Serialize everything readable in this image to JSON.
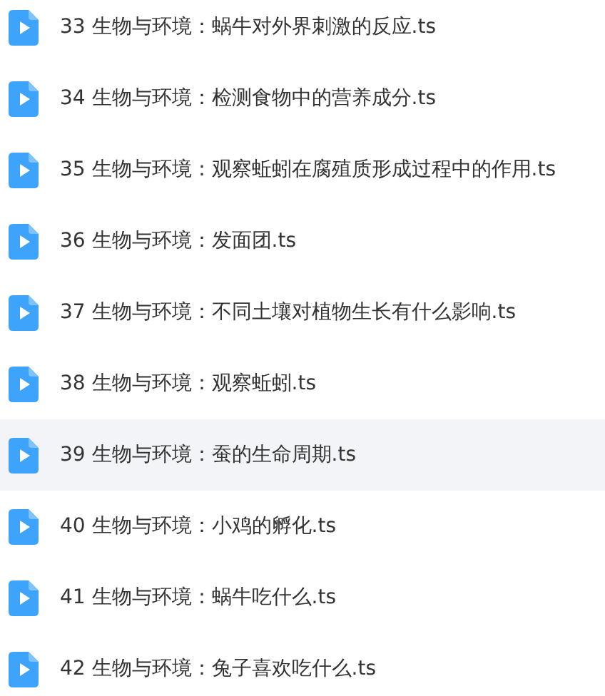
{
  "files": [
    {
      "name": "33 生物与环境：蜗牛对外界刺激的反应.ts",
      "selected": false
    },
    {
      "name": "34 生物与环境：检测食物中的营养成分.ts",
      "selected": false
    },
    {
      "name": "35 生物与环境：观察蚯蚓在腐殖质形成过程中的作用.ts",
      "selected": false
    },
    {
      "name": "36 生物与环境：发面团.ts",
      "selected": false
    },
    {
      "name": "37 生物与环境：不同土壤对植物生长有什么影响.ts",
      "selected": false
    },
    {
      "name": "38 生物与环境：观察蚯蚓.ts",
      "selected": false
    },
    {
      "name": "39 生物与环境：蚕的生命周期.ts",
      "selected": true
    },
    {
      "name": "40 生物与环境：小鸡的孵化.ts",
      "selected": false
    },
    {
      "name": "41 生物与环境：蜗牛吃什么.ts",
      "selected": false
    },
    {
      "name": "42 生物与环境：兔子喜欢吃什么.ts",
      "selected": false
    }
  ]
}
